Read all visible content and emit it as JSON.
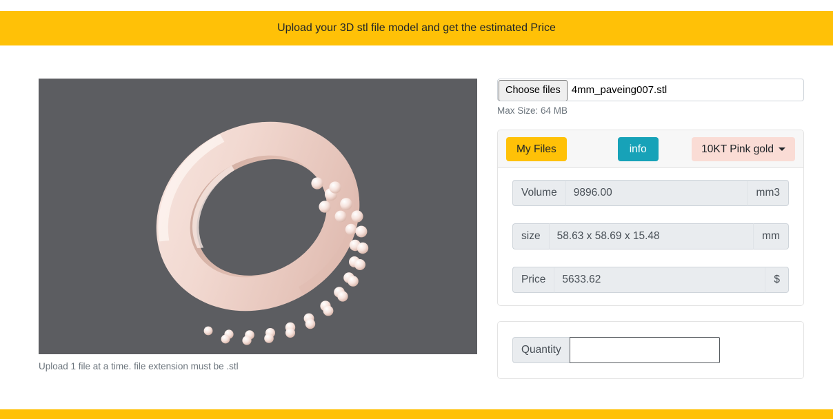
{
  "banner": {
    "title": "Upload your 3D stl file model and get the estimated Price"
  },
  "viewer": {
    "model_name": "ring-pave-3d-model",
    "background_color": "#5c5d61",
    "material_color": "#f0d9d2",
    "caption": "Upload 1 file at a time. file extension must be .stl"
  },
  "upload": {
    "choose_label": "Choose files",
    "file_name": "4mm_paveing007.stl",
    "max_size_text": "Max Size: 64 MB"
  },
  "toolbar": {
    "my_files_label": "My Files",
    "info_label": "info",
    "material_selected": "10KT Pink gold",
    "my_files_color": "#ffc107",
    "info_color": "#17a2b8",
    "material_color": "#fadcd5"
  },
  "results": {
    "rows": [
      {
        "label": "Volume",
        "value": "9896.00",
        "unit": "mm3"
      },
      {
        "label": "size",
        "value": "58.63 x 58.69 x 15.48",
        "unit": "mm"
      },
      {
        "label": "Price",
        "value": "5633.62",
        "unit": "$"
      }
    ]
  },
  "quantity": {
    "label": "Quantity",
    "value": "",
    "placeholder": ""
  }
}
